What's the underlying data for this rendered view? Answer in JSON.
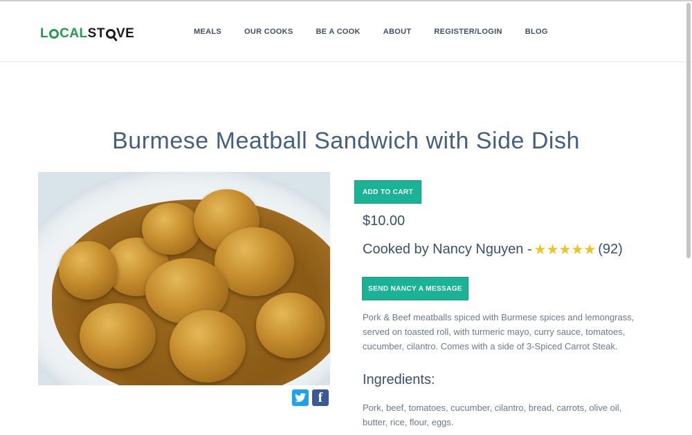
{
  "logo": {
    "part1": "L",
    "part2": "CAL",
    "part3": "ST",
    "part4": "VE"
  },
  "nav": [
    {
      "label": "MEALS"
    },
    {
      "label": "OUR COOKS"
    },
    {
      "label": "BE A COOK"
    },
    {
      "label": "ABOUT"
    },
    {
      "label": "REGISTER/LOGIN"
    },
    {
      "label": "BLOG"
    }
  ],
  "meal": {
    "title": "Burmese Meatball Sandwich with Side Dish",
    "add_to_cart_label": "ADD TO CART",
    "price": "$10.00",
    "cooked_by": "Cooked by Nancy Nguyen -",
    "stars": "★★★★★",
    "rating_count": "(92)",
    "rating_value": 5,
    "message_label": "SEND NANCY A MESSAGE",
    "description": "Pork & Beef meatballs spiced with Burmese spices and lemongrass, served on toasted roll, with turmeric mayo, curry sauce, tomatoes, cucumber, cilantro. Comes with a side of 3-Spiced Carrot Steak.",
    "ingredients_title": "Ingredients:",
    "ingredients": "Pork, beef, tomatoes, cucumber, cilantro, bread, carrots, olive oil, butter, rice, flour, eggs."
  },
  "social": {
    "twitter_icon": "twitter-icon",
    "facebook_icon": "facebook-icon"
  },
  "colors": {
    "accent": "#1bb395",
    "heading": "#45607e",
    "star": "#f2c31d",
    "logo_green": "#1e9d4c"
  }
}
